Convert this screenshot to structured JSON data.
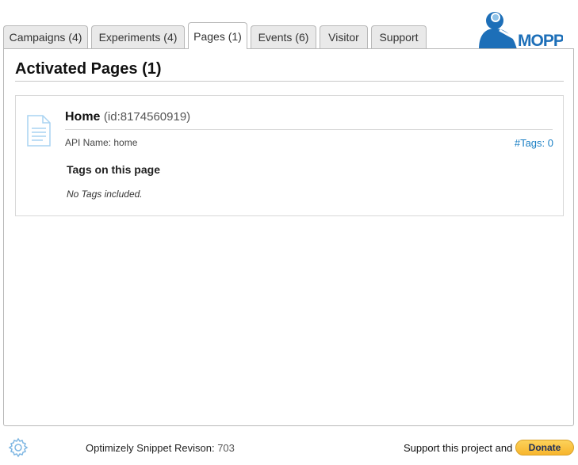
{
  "tabs": [
    {
      "label": "Campaigns (4)"
    },
    {
      "label": "Experiments (4)"
    },
    {
      "label": "Pages (1)"
    },
    {
      "label": "Events (6)"
    },
    {
      "label": "Visitor"
    },
    {
      "label": "Support"
    }
  ],
  "active_tab": "Pages (1)",
  "logo": {
    "text": "MOPPI",
    "color": "#1d6fb8"
  },
  "panel": {
    "title": "Activated Pages (1)",
    "page": {
      "name": "Home",
      "id_text": "(id:8174560919)",
      "api_name_label": "API Name: home",
      "tags_link": "#Tags: 0",
      "tags_heading": "Tags on this page",
      "no_tags_text": "No Tags included."
    }
  },
  "footer": {
    "revision_label": "Optimizely Snippet Revison:",
    "revision_number": "703",
    "support_text": "Support this project and",
    "donate_label": "Donate"
  },
  "colors": {
    "accent": "#1a7fc4",
    "donate": "#f7b52d",
    "tab_bg": "#e9e9e9"
  }
}
